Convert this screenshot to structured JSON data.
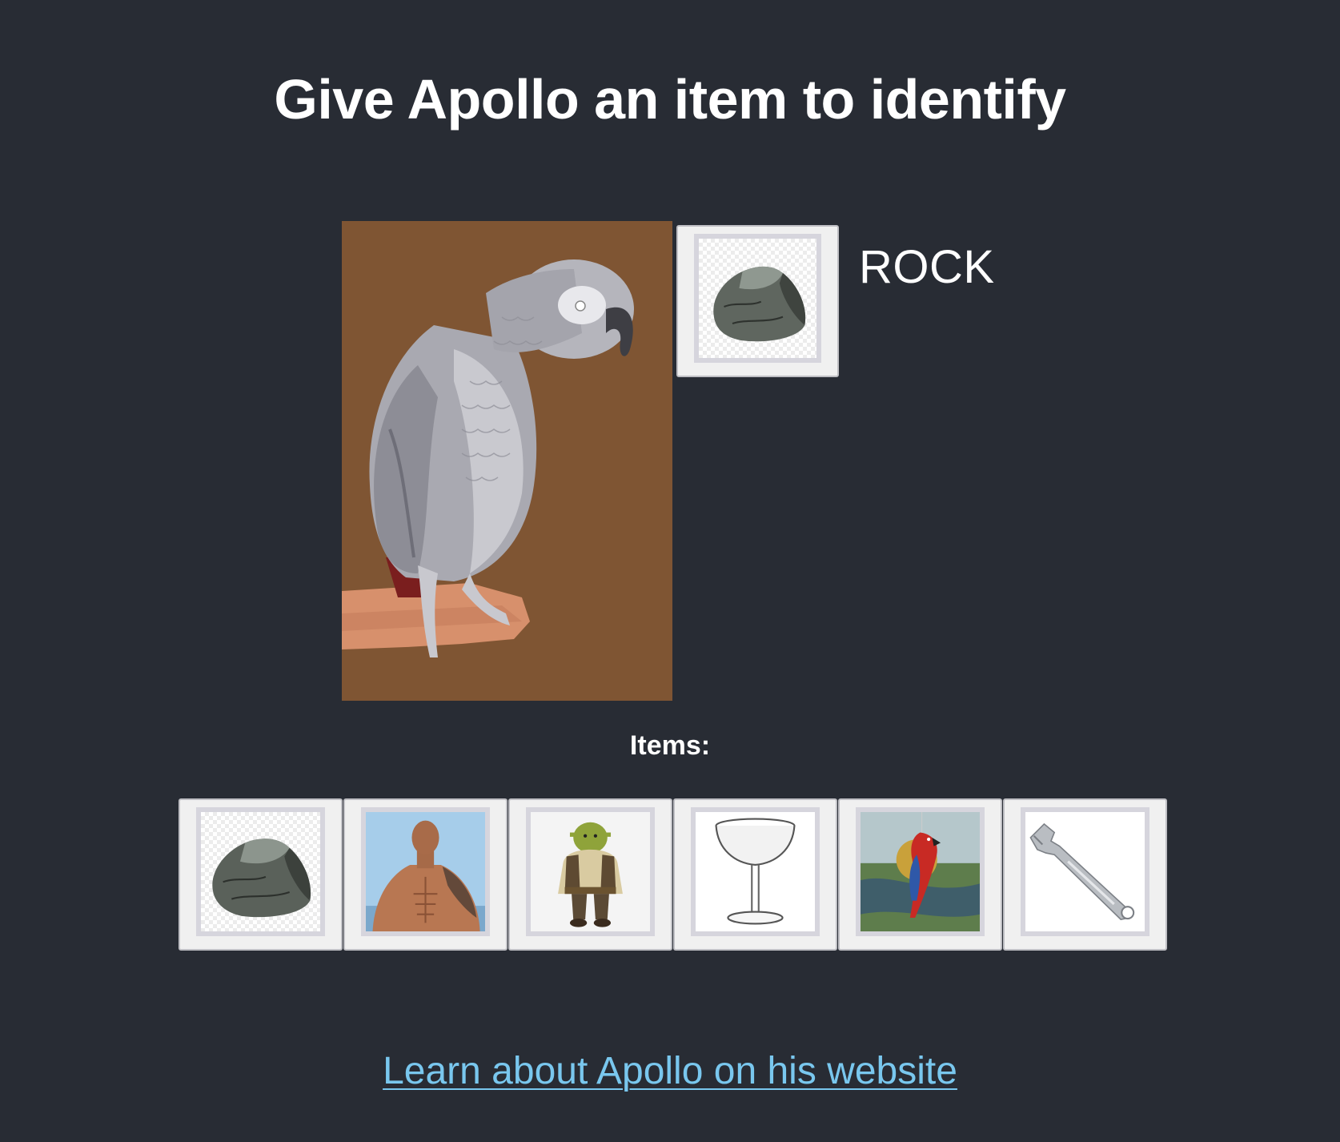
{
  "title": "Give Apollo an item to identify",
  "selected": {
    "label": "ROCK",
    "icon": "rock-icon"
  },
  "items_heading": "Items:",
  "items": [
    {
      "icon": "rock-icon"
    },
    {
      "icon": "muscular-man-photo"
    },
    {
      "icon": "ogre-character-icon"
    },
    {
      "icon": "cocktail-glass-icon"
    },
    {
      "icon": "stained-glass-parrot-icon"
    },
    {
      "icon": "wrench-icon"
    }
  ],
  "link_text": "Learn about Apollo on his website",
  "colors": {
    "background": "#282c34",
    "parrot_background": "#7f5533",
    "link": "#79c7ee"
  }
}
